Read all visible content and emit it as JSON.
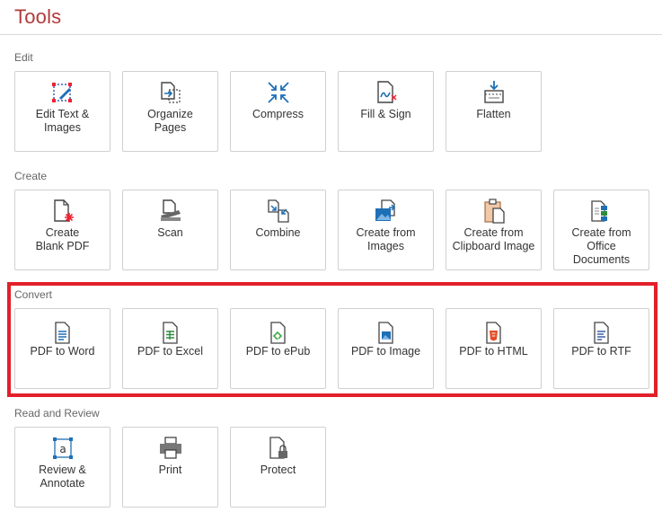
{
  "title": "Tools",
  "sections": {
    "edit": {
      "label": "Edit",
      "items": [
        {
          "label": "Edit Text &\nImages",
          "icon": "edit-text-images-icon"
        },
        {
          "label": "Organize\nPages",
          "icon": "organize-pages-icon"
        },
        {
          "label": "Compress",
          "icon": "compress-icon"
        },
        {
          "label": "Fill & Sign",
          "icon": "fill-sign-icon"
        },
        {
          "label": "Flatten",
          "icon": "flatten-icon"
        }
      ]
    },
    "create": {
      "label": "Create",
      "items": [
        {
          "label": "Create\nBlank PDF",
          "icon": "create-blank-pdf-icon"
        },
        {
          "label": "Scan",
          "icon": "scan-icon"
        },
        {
          "label": "Combine",
          "icon": "combine-icon"
        },
        {
          "label": "Create from\nImages",
          "icon": "create-from-images-icon"
        },
        {
          "label": "Create from\nClipboard Image",
          "icon": "create-from-clipboard-icon"
        },
        {
          "label": "Create from\nOffice\nDocuments",
          "icon": "create-from-office-icon"
        }
      ]
    },
    "convert": {
      "label": "Convert",
      "items": [
        {
          "label": "PDF to Word",
          "icon": "pdf-to-word-icon"
        },
        {
          "label": "PDF to Excel",
          "icon": "pdf-to-excel-icon"
        },
        {
          "label": "PDF to ePub",
          "icon": "pdf-to-epub-icon"
        },
        {
          "label": "PDF to Image",
          "icon": "pdf-to-image-icon"
        },
        {
          "label": "PDF to HTML",
          "icon": "pdf-to-html-icon"
        },
        {
          "label": "PDF to RTF",
          "icon": "pdf-to-rtf-icon"
        }
      ]
    },
    "review": {
      "label": "Read and Review",
      "items": [
        {
          "label": "Review &\nAnnotate",
          "icon": "review-annotate-icon"
        },
        {
          "label": "Print",
          "icon": "print-icon"
        },
        {
          "label": "Protect",
          "icon": "protect-icon"
        }
      ]
    }
  },
  "colors": {
    "accent": "#b23a3a",
    "highlight": "#e2202a",
    "icon_blue": "#1f6fb5"
  }
}
